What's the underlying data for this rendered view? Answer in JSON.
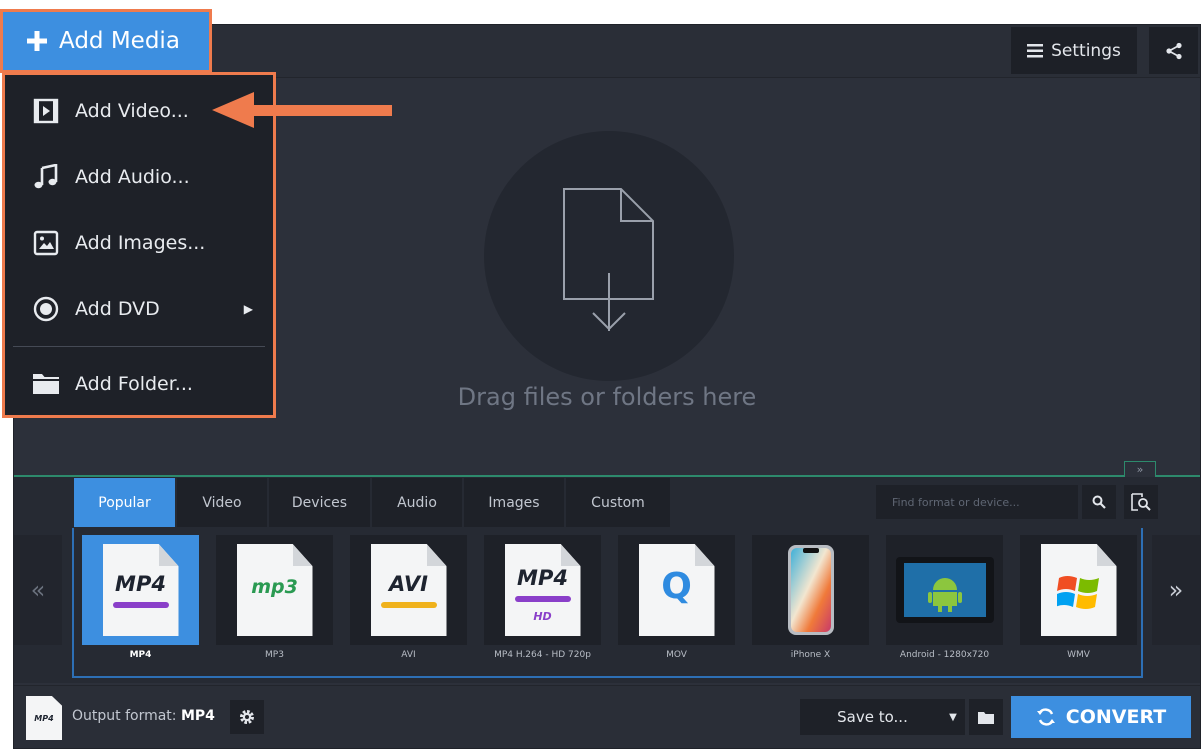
{
  "toolbar": {
    "add_media_label": "Add Media",
    "settings_label": "Settings"
  },
  "add_media_menu": {
    "items": [
      {
        "label": "Add Video...",
        "icon": "video-icon"
      },
      {
        "label": "Add Audio...",
        "icon": "music-note-icon"
      },
      {
        "label": "Add Images...",
        "icon": "image-icon"
      },
      {
        "label": "Add DVD",
        "icon": "disc-icon",
        "has_submenu": true
      },
      {
        "label": "Add Folder...",
        "icon": "folder-icon"
      }
    ]
  },
  "drop_zone": {
    "text": "Drag files or folders here"
  },
  "format_tabs": [
    "Popular",
    "Video",
    "Devices",
    "Audio",
    "Images",
    "Custom"
  ],
  "active_tab": "Popular",
  "format_search": {
    "placeholder": "Find format or device..."
  },
  "formats": [
    {
      "label": "MP4",
      "badge": "MP4",
      "selected": true
    },
    {
      "label": "MP3",
      "badge": "mp3"
    },
    {
      "label": "AVI",
      "badge": "AVI"
    },
    {
      "label": "MP4 H.264 - HD 720p",
      "badge": "MP4",
      "sub_badge": "HD"
    },
    {
      "label": "MOV",
      "badge": "Q"
    },
    {
      "label": "iPhone X"
    },
    {
      "label": "Android - 1280x720"
    },
    {
      "label": "WMV"
    }
  ],
  "bottom_bar": {
    "output_format_label": "Output format:",
    "output_format_value": "MP4",
    "output_icon_text": "MP4",
    "save_to_label": "Save to...",
    "convert_label": "CONVERT"
  },
  "colors": {
    "accent": "#3d8fe0",
    "highlight": "#ef7b4d",
    "panel_divider": "#2d8a6c"
  }
}
